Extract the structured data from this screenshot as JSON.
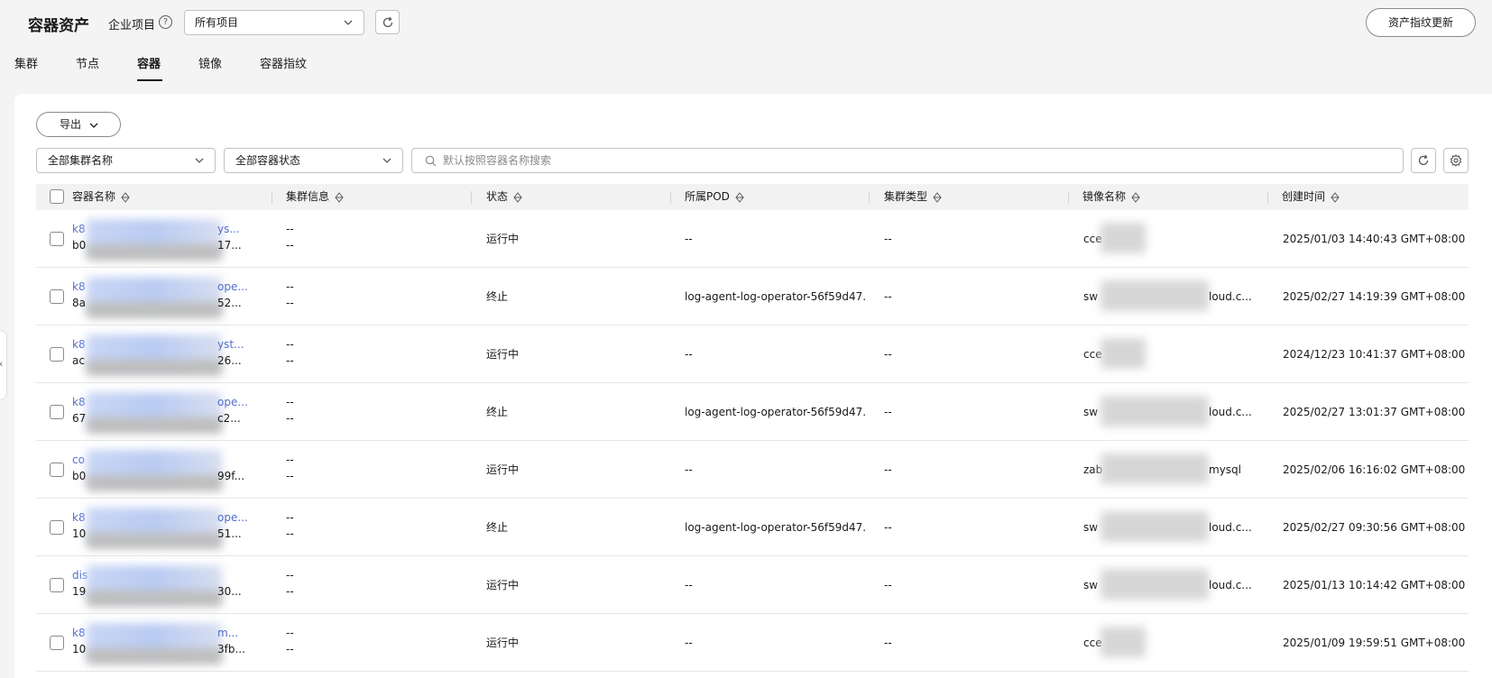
{
  "header": {
    "title": "容器资产",
    "project_label": "企业项目",
    "project_select": "所有项目",
    "update_button": "资产指纹更新"
  },
  "tabs": [
    "集群",
    "节点",
    "容器",
    "镜像",
    "容器指纹"
  ],
  "active_tab": "容器",
  "toolbar": {
    "export_label": "导出",
    "cluster_filter": "全部集群名称",
    "status_filter": "全部容器状态",
    "search_placeholder": "默认按照容器名称搜索"
  },
  "table": {
    "headers": [
      "容器名称",
      "集群信息",
      "状态",
      "所属POD",
      "集群类型",
      "镜像名称",
      "创建时间"
    ],
    "rows": [
      {
        "name_prefix": "k8",
        "name_suffix": "ys...",
        "id_prefix": "b0",
        "id_suffix": "17...",
        "cluster_line1": "--",
        "cluster_line2": "--",
        "status": "运行中",
        "pod": "--",
        "cluster_type": "--",
        "image_prefix": "cce",
        "image_suffix": "",
        "created": "2025/01/03 14:40:43 GMT+08:00"
      },
      {
        "name_prefix": "k8",
        "name_suffix": "ope...",
        "id_prefix": "8a",
        "id_suffix": "52...",
        "cluster_line1": "--",
        "cluster_line2": "--",
        "status": "终止",
        "pod": "log-agent-log-operator-56f59d47...",
        "cluster_type": "--",
        "image_prefix": "sw",
        "image_suffix": "loud.c...",
        "created": "2025/02/27 14:19:39 GMT+08:00"
      },
      {
        "name_prefix": "k8",
        "name_suffix": "yst...",
        "id_prefix": "ac",
        "id_suffix": "26...",
        "cluster_line1": "--",
        "cluster_line2": "--",
        "status": "运行中",
        "pod": "--",
        "cluster_type": "--",
        "image_prefix": "cce",
        "image_suffix": "",
        "created": "2024/12/23 10:41:37 GMT+08:00"
      },
      {
        "name_prefix": "k8",
        "name_suffix": "ope...",
        "id_prefix": "67",
        "id_suffix": "c2...",
        "cluster_line1": "--",
        "cluster_line2": "--",
        "status": "终止",
        "pod": "log-agent-log-operator-56f59d47...",
        "cluster_type": "--",
        "image_prefix": "sw",
        "image_suffix": "loud.c...",
        "created": "2025/02/27 13:01:37 GMT+08:00"
      },
      {
        "name_prefix": "co",
        "name_suffix": "",
        "id_prefix": "b0",
        "id_suffix": "99f...",
        "cluster_line1": "--",
        "cluster_line2": "--",
        "status": "运行中",
        "pod": "--",
        "cluster_type": "--",
        "image_prefix": "zab",
        "image_suffix": "mysql",
        "created": "2025/02/06 16:16:02 GMT+08:00"
      },
      {
        "name_prefix": "k8",
        "name_suffix": "ope...",
        "id_prefix": "10",
        "id_suffix": "51...",
        "cluster_line1": "--",
        "cluster_line2": "--",
        "status": "终止",
        "pod": "log-agent-log-operator-56f59d47...",
        "cluster_type": "--",
        "image_prefix": "sw",
        "image_suffix": "loud.c...",
        "created": "2025/02/27 09:30:56 GMT+08:00"
      },
      {
        "name_prefix": "dis",
        "name_suffix": "",
        "id_prefix": "19",
        "id_suffix": "30...",
        "cluster_line1": "--",
        "cluster_line2": "--",
        "status": "运行中",
        "pod": "--",
        "cluster_type": "--",
        "image_prefix": "sw",
        "image_suffix": "loud.c...",
        "created": "2025/01/13 10:14:42 GMT+08:00"
      },
      {
        "name_prefix": "k8",
        "name_suffix": "m...",
        "id_prefix": "10",
        "id_suffix": "3fb...",
        "cluster_line1": "--",
        "cluster_line2": "--",
        "status": "运行中",
        "pod": "--",
        "cluster_type": "--",
        "image_prefix": "cce",
        "image_suffix": "",
        "created": "2025/01/09 19:59:51 GMT+08:00"
      }
    ]
  },
  "sidebar_toggle": "‹",
  "colors": {
    "link": "#526ecc",
    "text": "#191919",
    "header_bg": "#f2f2f2",
    "page_bg": "#f4f4f4"
  }
}
